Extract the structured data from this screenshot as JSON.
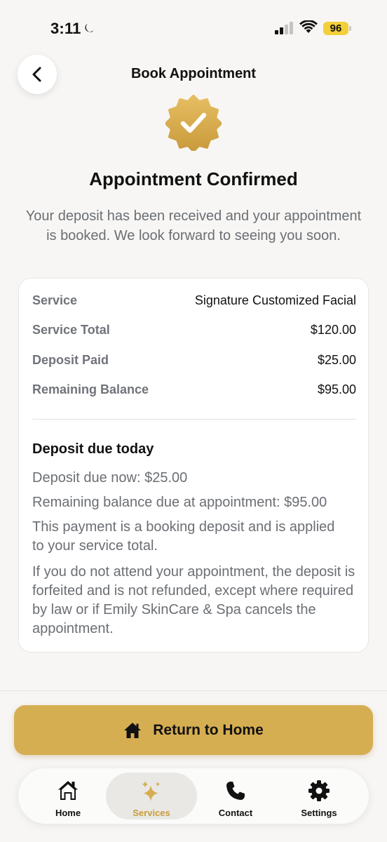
{
  "status_bar": {
    "time": "3:11",
    "battery": "96"
  },
  "header": {
    "title": "Book Appointment"
  },
  "confirmation": {
    "title": "Appointment Confirmed",
    "message": "Your deposit has been received and your appointment is booked. We look forward to seeing you soon."
  },
  "summary": {
    "rows": [
      {
        "label": "Service",
        "value": "Signature Customized Facial"
      },
      {
        "label": "Service Total",
        "value": "$120.00"
      },
      {
        "label": "Deposit Paid",
        "value": "$25.00"
      },
      {
        "label": "Remaining Balance",
        "value": "$95.00"
      }
    ],
    "deposit_title": "Deposit due today",
    "details": [
      "Deposit due now: $25.00",
      "Remaining balance due at appointment: $95.00",
      "This payment is a booking deposit and is applied to your service total.",
      "If you do not attend your appointment, the deposit is forfeited and is not refunded, except where required by law or if Emily SkinCare & Spa cancels the appointment."
    ]
  },
  "actions": {
    "return_label": "Return to Home"
  },
  "tabs": [
    {
      "label": "Home",
      "icon": "home-icon",
      "active": false
    },
    {
      "label": "Services",
      "icon": "sparkles-icon",
      "active": true
    },
    {
      "label": "Contact",
      "icon": "phone-icon",
      "active": false
    },
    {
      "label": "Settings",
      "icon": "gear-icon",
      "active": false
    }
  ],
  "colors": {
    "accent_gold": "#d6ae52",
    "active_tab_text": "#c99d3a",
    "battery_yellow": "#f3cf3a",
    "background": "#f7f6f4"
  }
}
